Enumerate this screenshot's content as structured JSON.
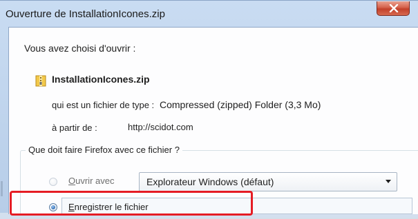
{
  "dialog": {
    "title": "Ouverture de InstallationIcones.zip"
  },
  "content": {
    "intro": "Vous avez choisi d'ouvrir :",
    "file": {
      "name": "InstallationIcones.zip",
      "icon": "zip-folder-icon"
    },
    "type_label": "qui est un fichier de type :",
    "type_value": "Compressed (zipped) Folder (3,3 Mo)",
    "from_label": "à partir de :",
    "from_value": "http://scidot.com"
  },
  "options": {
    "question": "Que doit faire Firefox avec ce fichier ?",
    "open_with": {
      "label_hotkey": "O",
      "label_rest": "uvrir avec",
      "selected": false,
      "app_value": "Explorateur Windows (défaut)"
    },
    "save": {
      "label_hotkey": "E",
      "label_rest": "nregistrer le fichier",
      "selected": true
    }
  },
  "colors": {
    "highlight_box": "#e51c24",
    "close_button": "#c2402a"
  }
}
